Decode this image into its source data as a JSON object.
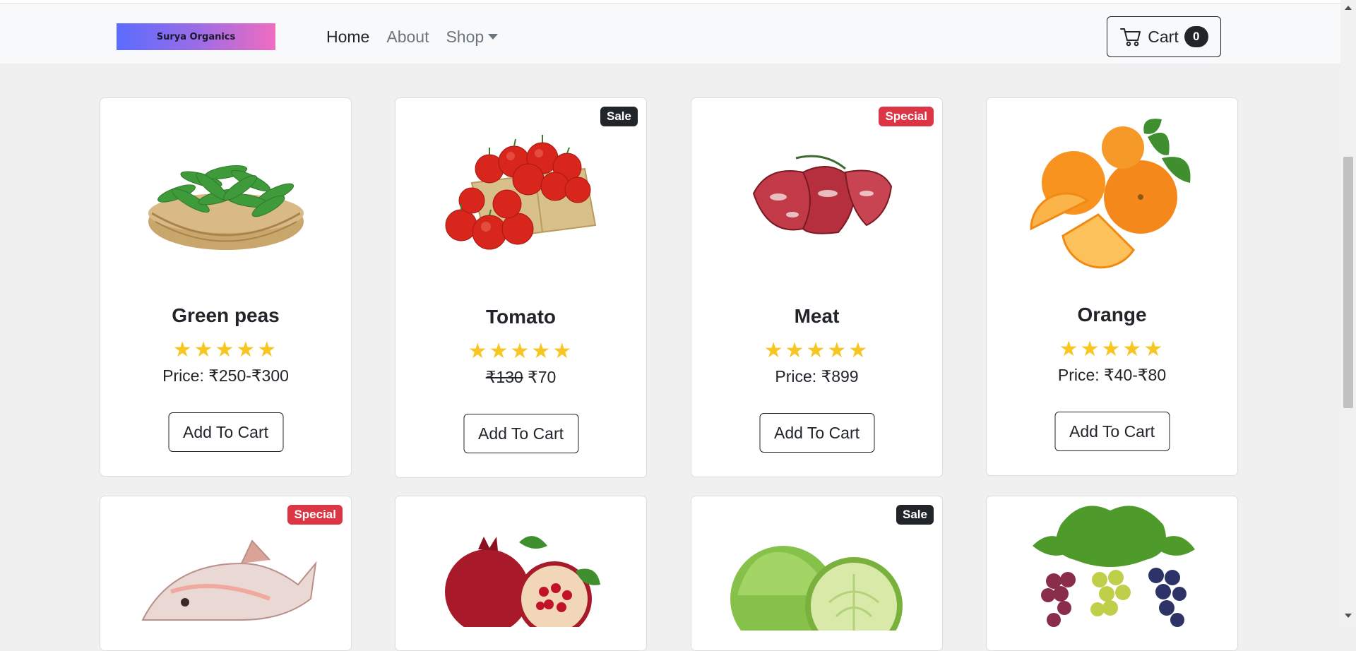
{
  "brand": {
    "name": "Surya Organics"
  },
  "nav": {
    "home": "Home",
    "about": "About",
    "shop": "Shop"
  },
  "cart": {
    "label": "Cart",
    "count": "0"
  },
  "products": [
    {
      "name": "Green peas",
      "rating": 5,
      "price": "Price: ₹250-₹300",
      "button": "Add To Cart",
      "icon": "green-peas-image"
    },
    {
      "name": "Tomato",
      "rating": 5,
      "old_price": "₹130",
      "new_price": "₹70",
      "badge": "Sale",
      "button": "Add To Cart",
      "icon": "tomato-image"
    },
    {
      "name": "Meat",
      "rating": 5,
      "price": "Price: ₹899",
      "badge": "Special",
      "button": "Add To Cart",
      "icon": "meat-image"
    },
    {
      "name": "Orange",
      "rating": 5,
      "price": "Price: ₹40-₹80",
      "button": "Add To Cart",
      "icon": "orange-image"
    },
    {
      "badge": "Special",
      "icon": "fish-image"
    },
    {
      "icon": "pomegranate-image"
    },
    {
      "badge": "Sale",
      "icon": "cabbage-image"
    },
    {
      "icon": "grapes-image"
    }
  ],
  "colors": {
    "sale_badge": "#212529",
    "special_badge": "#dc3545",
    "star": "#f7c623"
  }
}
